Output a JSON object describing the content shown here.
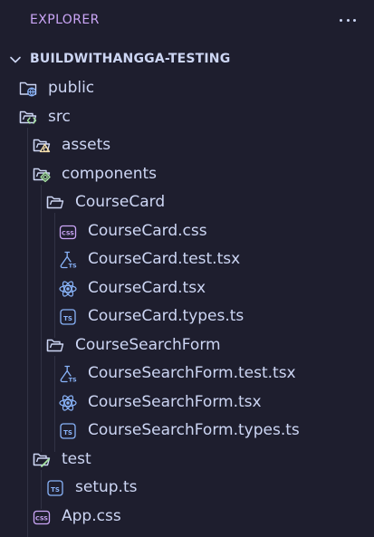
{
  "explorer": {
    "title": "EXPLORER",
    "more_actions_icon": "ellipsis-icon"
  },
  "workspace": {
    "name": "BUILDWITHANGGA-TESTING",
    "expanded": true
  },
  "tree": [
    {
      "label": "public",
      "kind": "folder",
      "icon": "folder-public-icon",
      "depth": 0
    },
    {
      "label": "src",
      "kind": "folder-open",
      "icon": "folder-src-icon",
      "depth": 0
    },
    {
      "label": "assets",
      "kind": "folder",
      "icon": "folder-assets-icon",
      "depth": 1
    },
    {
      "label": "components",
      "kind": "folder-open",
      "icon": "folder-components-icon",
      "depth": 1
    },
    {
      "label": "CourseCard",
      "kind": "folder-open",
      "icon": "folder-open-icon",
      "depth": 2
    },
    {
      "label": "CourseCard.css",
      "kind": "file",
      "icon": "css-file-icon",
      "depth": 3
    },
    {
      "label": "CourseCard.test.tsx",
      "kind": "file",
      "icon": "test-ts-file-icon",
      "depth": 3
    },
    {
      "label": "CourseCard.tsx",
      "kind": "file",
      "icon": "react-file-icon",
      "depth": 3
    },
    {
      "label": "CourseCard.types.ts",
      "kind": "file",
      "icon": "ts-file-icon",
      "depth": 3
    },
    {
      "label": "CourseSearchForm",
      "kind": "folder-open",
      "icon": "folder-open-icon",
      "depth": 2
    },
    {
      "label": "CourseSearchForm.test.tsx",
      "kind": "file",
      "icon": "test-ts-file-icon",
      "depth": 3
    },
    {
      "label": "CourseSearchForm.tsx",
      "kind": "file",
      "icon": "react-file-icon",
      "depth": 3
    },
    {
      "label": "CourseSearchForm.types.ts",
      "kind": "file",
      "icon": "ts-file-icon",
      "depth": 3
    },
    {
      "label": "test",
      "kind": "folder-open",
      "icon": "folder-test-icon",
      "depth": 1
    },
    {
      "label": "setup.ts",
      "kind": "file",
      "icon": "ts-file-icon",
      "depth": 2
    },
    {
      "label": "App.css",
      "kind": "file",
      "icon": "css-file-icon",
      "depth": 1
    }
  ],
  "colors": {
    "background": "#1e1e2e",
    "text": "#cdd6f4",
    "accent": "#cba6f7",
    "folder": "#cdd6f4",
    "folder_badge_public": "#89b4fa",
    "folder_badge_src": "#a6e3a1",
    "folder_badge_assets": "#f9e2af",
    "folder_badge_components": "#a6e3a1",
    "folder_badge_test": "#a6e3a1",
    "css_icon": "#cba6f7",
    "ts_icon": "#89b4fa",
    "react_icon": "#89b4fa"
  }
}
